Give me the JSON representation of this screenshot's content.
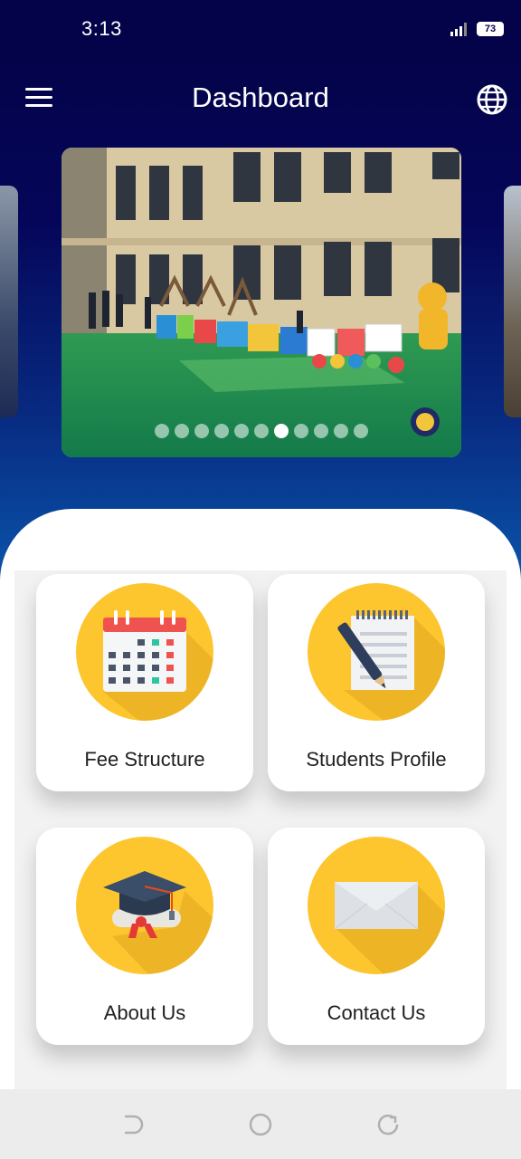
{
  "status_bar": {
    "time": "3:13",
    "battery": "73",
    "icons": [
      "signal-icon",
      "battery-icon"
    ]
  },
  "header": {
    "title": "Dashboard",
    "menu_icon": "hamburger-menu-icon",
    "language_icon": "globe-icon",
    "background_colors": [
      "#04034a",
      "#0a5ab0"
    ]
  },
  "carousel": {
    "slide_count": 11,
    "active_index": 6
  },
  "cards": [
    {
      "label": "Fee Structure",
      "icon": "calendar-icon"
    },
    {
      "label": "Students Profile",
      "icon": "notepad-pen-icon"
    },
    {
      "label": "About Us",
      "icon": "graduation-cap-icon"
    },
    {
      "label": "Contact Us",
      "icon": "envelope-icon"
    }
  ],
  "colors": {
    "accent_yellow": "#fdc52e",
    "card_bg": "#ffffff"
  },
  "nav_bar": {
    "buttons": [
      "back-icon",
      "home-icon",
      "recent-apps-icon"
    ]
  }
}
